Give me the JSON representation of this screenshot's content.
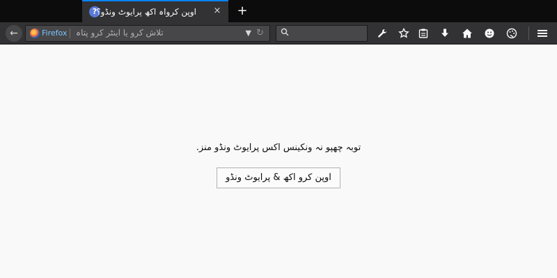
{
  "tab": {
    "title": "اوپن کرواہ اکھ پرایوٹ ونڈو؟",
    "icon": "question-icon",
    "close": "×"
  },
  "toolbar": {
    "new_tab": "+",
    "back": "←",
    "identity_label": "Firefox",
    "url_placeholder": "تلاش کرو یا اینٹر کرو پتاہ",
    "dropdown": "▼",
    "reload": "↻",
    "icons": {
      "tools": "wrench-icon",
      "bookmark": "star-icon",
      "library": "clipboard-icon",
      "download": "download-icon",
      "home": "home-icon",
      "feedback": "smiley-icon",
      "theme": "palette-icon",
      "menu": "hamburger-menu-icon"
    },
    "accent_color": "#0a84ff"
  },
  "content": {
    "message": "توبہ چھپو نہ ونکینس اکس پرایوٹ ونڈو منز.",
    "button_label": "اوپن کرو اکھ & پرایوٹ ونڈو"
  }
}
